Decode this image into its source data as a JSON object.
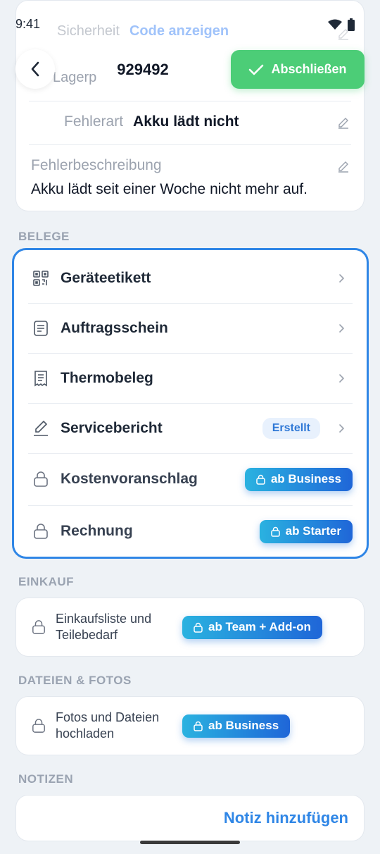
{
  "status": {
    "time": "9:41"
  },
  "header": {
    "order_id": "929492",
    "finish_label": "Abschließen"
  },
  "details": {
    "security_label": "Sicherheit",
    "security_value": "Code anzeigen",
    "storage_label_partial": "Lagerp",
    "error_type_label": "Fehlerart",
    "error_type_value": "Akku lädt nicht",
    "description_label": "Fehlerbeschreibung",
    "description_value": "Akku lädt seit einer Woche nicht mehr auf."
  },
  "sections": {
    "belege": "BELEGE",
    "einkauf": "EINKAUF",
    "dateien": "DATEIEN & FOTOS",
    "notizen": "NOTIZEN"
  },
  "belege": [
    {
      "label": "Geräteetikett",
      "icon": "qr-code-icon"
    },
    {
      "label": "Auftragsschein",
      "icon": "document-icon"
    },
    {
      "label": "Thermobeleg",
      "icon": "receipt-icon"
    },
    {
      "label": "Servicebericht",
      "icon": "pencil-icon",
      "badge": "Erstellt"
    },
    {
      "label": "Kostenvoranschlag",
      "icon": "lock-icon",
      "plan": "ab Business"
    },
    {
      "label": "Rechnung",
      "icon": "lock-icon",
      "plan": "ab Starter"
    }
  ],
  "einkauf": {
    "label": "Einkaufsliste und Teilebedarf",
    "plan": "ab Team + Add-on"
  },
  "dateien": {
    "label": "Fotos und Dateien hochladen",
    "plan": "ab Business"
  },
  "notizen": {
    "add_label": "Notiz hinzufügen"
  },
  "colors": {
    "accent": "#2f86e6",
    "success": "#4ccd77",
    "background": "#eef2f6"
  }
}
